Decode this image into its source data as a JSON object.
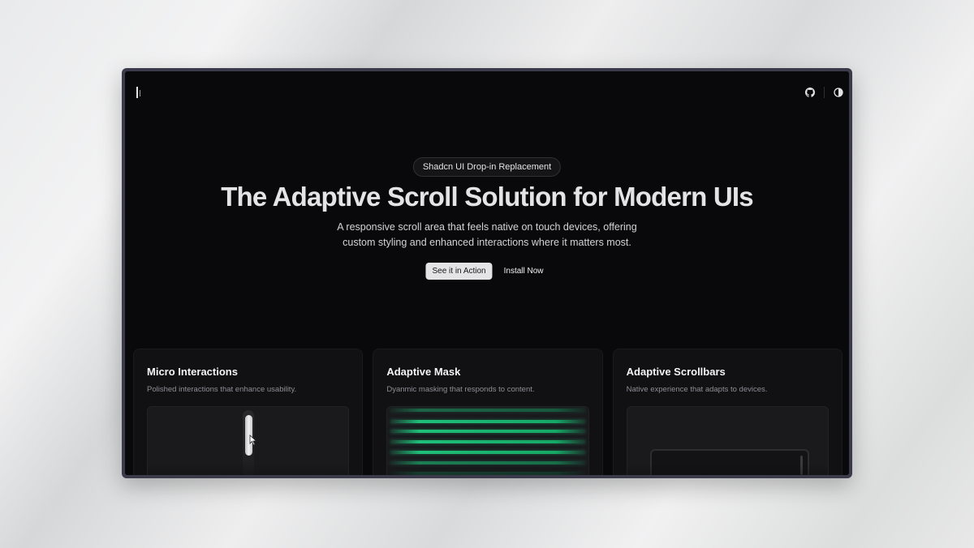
{
  "hero": {
    "badge": "Shadcn UI Drop-in Replacement",
    "title": "The Adaptive Scroll Solution for Modern UIs",
    "subtitle": "A responsive scroll area that feels native on touch devices, offering custom styling and enhanced interactions where it matters most.",
    "primary_cta": "See it in Action",
    "secondary_cta": "Install Now"
  },
  "header": {
    "icons": [
      "github-icon",
      "theme-toggle-icon"
    ]
  },
  "features": [
    {
      "title": "Micro Interactions",
      "description": "Polished interactions that enhance usability."
    },
    {
      "title": "Adaptive Mask",
      "description": "Dyanmic masking that responds to content."
    },
    {
      "title": "Adaptive Scrollbars",
      "description": "Native experience that adapts to devices."
    }
  ],
  "colors": {
    "background": "#09090b",
    "card": "#111113",
    "accent_green": "#1fbf7a",
    "text": "#e4e4e7"
  }
}
